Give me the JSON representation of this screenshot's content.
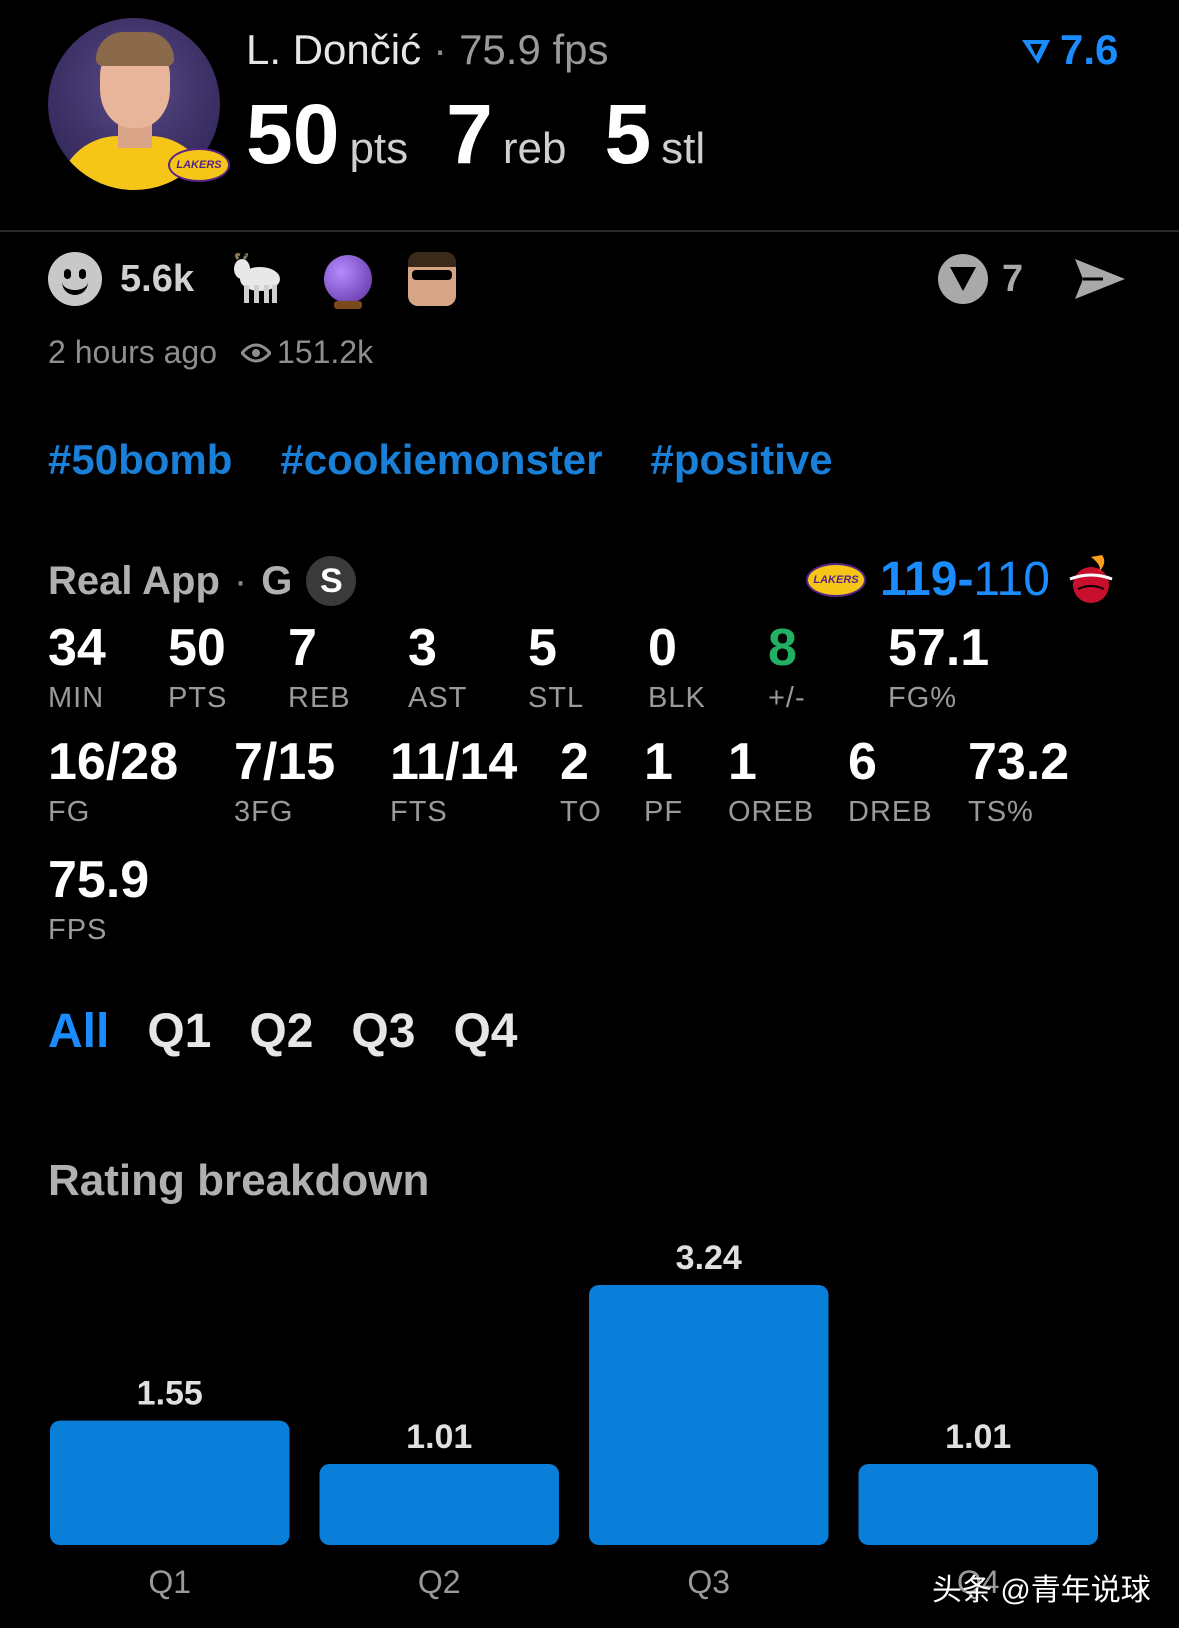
{
  "player": {
    "name": "L. Dončić",
    "fps_label": "75.9 fps",
    "rating": "7.6",
    "headline_stats": [
      {
        "value": "50",
        "unit": "pts"
      },
      {
        "value": "7",
        "unit": "reb"
      },
      {
        "value": "5",
        "unit": "stl"
      }
    ],
    "team_logo_text": "LAKERS"
  },
  "reactions": {
    "count": "5.6k",
    "emojis": [
      "goat-emoji",
      "crystal-ball-emoji",
      "sunglasses-face-emoji"
    ],
    "vote_count": "7"
  },
  "meta": {
    "time": "2 hours ago",
    "views": "151.2k"
  },
  "hashtags": [
    "#50bomb",
    "#cookiemonster",
    "#positive"
  ],
  "game": {
    "source": "Real App",
    "position": "G",
    "badge": "S",
    "home_logo": "LAKERS",
    "score_win": "119",
    "score_sep": "-",
    "score_lose": "110"
  },
  "stats_row1": [
    {
      "value": "34",
      "label": "MIN"
    },
    {
      "value": "50",
      "label": "PTS"
    },
    {
      "value": "7",
      "label": "REB"
    },
    {
      "value": "3",
      "label": "AST"
    },
    {
      "value": "5",
      "label": "STL"
    },
    {
      "value": "0",
      "label": "BLK"
    },
    {
      "value": "8",
      "label": "+/-"
    },
    {
      "value": "57.1",
      "label": "FG%"
    }
  ],
  "stats_row2": [
    {
      "value": "16/28",
      "label": "FG"
    },
    {
      "value": "7/15",
      "label": "3FG"
    },
    {
      "value": "11/14",
      "label": "FTS"
    },
    {
      "value": "2",
      "label": "TO"
    },
    {
      "value": "1",
      "label": "PF"
    },
    {
      "value": "1",
      "label": "OREB"
    },
    {
      "value": "6",
      "label": "DREB"
    },
    {
      "value": "73.2",
      "label": "TS%"
    }
  ],
  "stats_row3": [
    {
      "value": "75.9",
      "label": "FPS"
    }
  ],
  "quarter_tabs": [
    "All",
    "Q1",
    "Q2",
    "Q3",
    "Q4"
  ],
  "rating_breakdown_title": "Rating breakdown",
  "chart_data": {
    "type": "bar",
    "categories": [
      "Q1",
      "Q2",
      "Q3",
      "Q4"
    ],
    "values": [
      1.55,
      1.01,
      3.24,
      1.01
    ],
    "value_labels": [
      "1.55",
      "1.01",
      "3.24",
      "1.01"
    ],
    "bar_color": "#0a7fd9",
    "grid": false
  },
  "watermark": "头条 @青年说球",
  "colors": {
    "accent": "#1a8cff",
    "positive": "#22b062",
    "background": "#000000"
  }
}
